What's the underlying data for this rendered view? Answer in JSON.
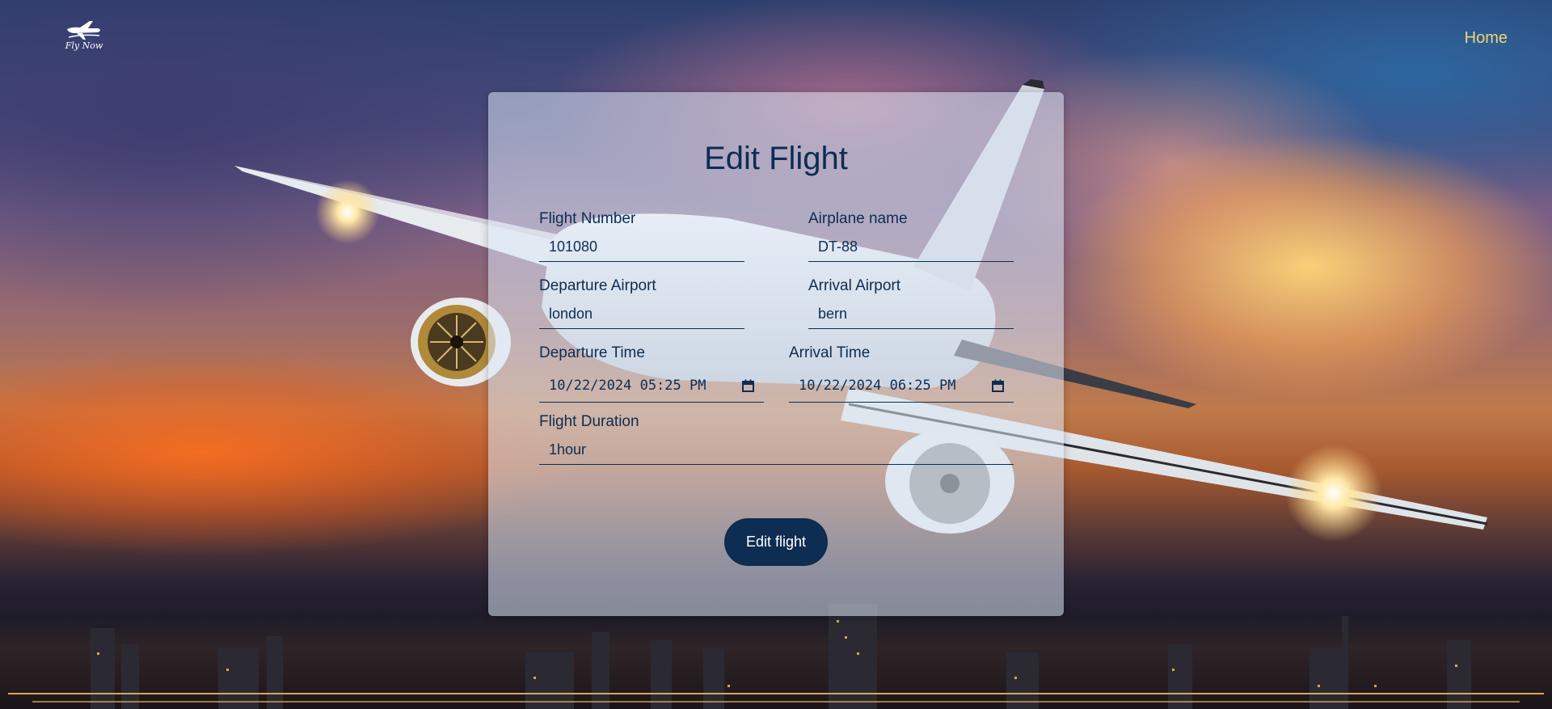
{
  "header": {
    "logo_text": "Fly Now",
    "nav_home": "Home"
  },
  "form": {
    "title": "Edit Flight",
    "fields": {
      "flight_number": {
        "label": "Flight Number",
        "value": "101080"
      },
      "airplane_name": {
        "label": "Airplane name",
        "value": "DT-88"
      },
      "departure_airport": {
        "label": "Departure Airport",
        "value": "london"
      },
      "arrival_airport": {
        "label": "Arrival Airport",
        "value": "bern"
      },
      "departure_time": {
        "label": "Departure Time",
        "value": "10/22/2024 05:25 PM"
      },
      "arrival_time": {
        "label": "Arrival Time",
        "value": "10/22/2024 06:25 PM"
      },
      "flight_duration": {
        "label": "Flight Duration",
        "value": "1hour"
      }
    },
    "submit_label": "Edit flight"
  },
  "colors": {
    "primary": "#0d2d52",
    "nav_link": "#f1d47a",
    "card_background": "rgba(220,232,245,0.55)"
  },
  "icons": {
    "logo": "airplane-logo-icon",
    "calendar": "calendar-icon"
  }
}
